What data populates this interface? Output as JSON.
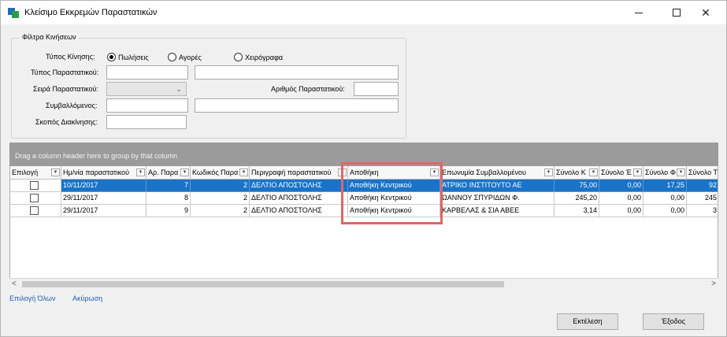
{
  "window": {
    "title": "Κλείσιμο Εκκρεμών Παραστατικών"
  },
  "filters": {
    "group_title": "Φίλτρα Κινήσεων",
    "movement_type_label": "Τύπος Κίνησης:",
    "movement_type_options": [
      "Πωλήσεις",
      "Αγορές",
      "Χειρόγραφα"
    ],
    "movement_type_selected": "Πωλήσεις",
    "doc_type_label": "Τύπος Παραστατικού:",
    "doc_type_code": "",
    "doc_type_desc": "",
    "series_label": "Σειρά Παραστατικού:",
    "series_value": "",
    "doc_number_label": "Αριθμός Παραστατικού:",
    "doc_number_value": "",
    "counterparty_label": "Συμβαλλόμενος:",
    "counterparty_code": "",
    "counterparty_name": "",
    "purpose_label": "Σκοπός Διακίνησης:",
    "purpose_value": ""
  },
  "grid": {
    "group_panel_text": "Drag a column header here to group by that column",
    "columns": [
      "Επιλογή",
      "Ημ/νία παραστατικού",
      "Αρ. Παρα",
      "Κωδικός Παρα",
      "Περιγραφή παραστατικού",
      "Αποθήκη",
      "Επωνυμία Συμβαλλομένου",
      "Σύνολο Κ",
      "Σύνολο Έ",
      "Σύνολο Φ",
      "Σύνολο Τ"
    ],
    "rows": [
      {
        "checked": false,
        "date": "10/11/2017",
        "number": "7",
        "code": "2",
        "description": "ΔΕΛΤΙΟ ΑΠΟΣΤΟΛΗΣ",
        "warehouse": "Αποθήκη Κεντρικού",
        "counterparty": "ΑΤΡΙΚΟ ΙΝΣΤΙΤΟΥΤΟ ΑΕ",
        "total_k": "75,00",
        "total_e": "0,00",
        "total_f": "17,25",
        "total_t": "92",
        "selected": true
      },
      {
        "checked": false,
        "date": "29/11/2017",
        "number": "8",
        "code": "2",
        "description": "ΔΕΛΤΙΟ ΑΠΟΣΤΟΛΗΣ",
        "warehouse": "Αποθήκη Κεντρικού",
        "counterparty": "ΩΑΝΝΟΥ ΣΠΥΡΙΔΩΝ Φ.",
        "total_k": "245,20",
        "total_e": "0,00",
        "total_f": "0,00",
        "total_t": "245",
        "selected": false
      },
      {
        "checked": false,
        "date": "29/11/2017",
        "number": "9",
        "code": "2",
        "description": "ΔΕΛΤΙΟ ΑΠΟΣΤΟΛΗΣ",
        "warehouse": "Αποθήκη Κεντρικού",
        "counterparty": "ΚΑΡΒΕΛΑΣ & ΣΙΑ ΑΒΕΕ",
        "total_k": "3,14",
        "total_e": "0,00",
        "total_f": "0,00",
        "total_t": "3",
        "selected": false
      }
    ],
    "scroll_left": "<",
    "scroll_right": ">"
  },
  "links": {
    "select_all": "Επιλογή Όλων",
    "cancel": "Ακύρωση"
  },
  "buttons": {
    "execute": "Εκτέλεση",
    "exit": "Έξοδος"
  },
  "colors": {
    "selected_row": "#1a73c7",
    "highlight_box": "#e06666",
    "group_panel": "#9b9b9b"
  }
}
